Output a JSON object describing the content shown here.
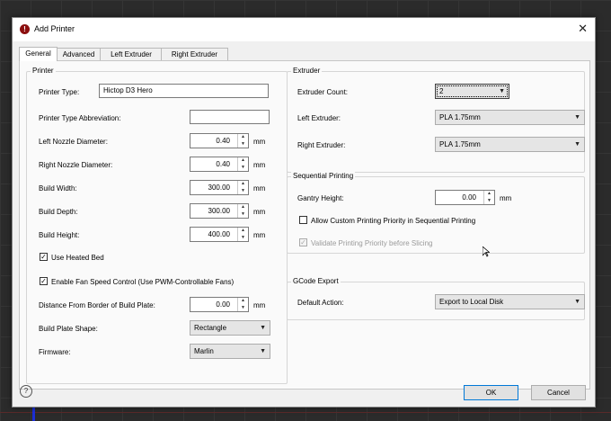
{
  "window": {
    "title": "Add Printer",
    "close_glyph": "✕",
    "app_icon_glyph": "!"
  },
  "tabs": [
    {
      "label": "General",
      "active": true
    },
    {
      "label": "Advanced",
      "active": false
    },
    {
      "label": "Left Extruder",
      "active": false
    },
    {
      "label": "Right Extruder",
      "active": false
    }
  ],
  "printer_group": {
    "title": "Printer",
    "printer_type": {
      "label": "Printer Type:",
      "value": "Hictop D3 Hero"
    },
    "abbreviation": {
      "label": "Printer Type Abbreviation:",
      "value": ""
    },
    "left_nozzle": {
      "label": "Left Nozzle Diameter:",
      "value": "0.40",
      "unit": "mm"
    },
    "right_nozzle": {
      "label": "Right Nozzle Diameter:",
      "value": "0.40",
      "unit": "mm"
    },
    "build_width": {
      "label": "Build Width:",
      "value": "300.00",
      "unit": "mm"
    },
    "build_depth": {
      "label": "Build Depth:",
      "value": "300.00",
      "unit": "mm"
    },
    "build_height": {
      "label": "Build Height:",
      "value": "400.00",
      "unit": "mm"
    },
    "heated_bed": {
      "label": "Use Heated Bed",
      "checked": true
    },
    "fan_speed": {
      "label": "Enable Fan Speed Control (Use PWM-Controllable Fans)",
      "checked": true
    },
    "border_distance": {
      "label": "Distance From Border of Build Plate:",
      "value": "0.00",
      "unit": "mm"
    },
    "plate_shape": {
      "label": "Build Plate Shape:",
      "value": "Rectangle"
    },
    "firmware": {
      "label": "Firmware:",
      "value": "Marlin"
    }
  },
  "extruder_group": {
    "title": "Extruder",
    "count": {
      "label": "Extruder Count:",
      "value": "2"
    },
    "left": {
      "label": "Left Extruder:",
      "value": "PLA 1.75mm"
    },
    "right": {
      "label": "Right Extruder:",
      "value": "PLA 1.75mm"
    }
  },
  "sequential_group": {
    "title": "Sequential Printing",
    "gantry_height": {
      "label": "Gantry Height:",
      "value": "0.00",
      "unit": "mm"
    },
    "custom_priority": {
      "label": "Allow Custom Printing Priority in Sequential Printing",
      "checked": false
    },
    "validate_priority": {
      "label": "Validate Printing Priority before Slicing",
      "checked": true,
      "disabled": true
    }
  },
  "gcode_group": {
    "title": "GCode Export",
    "default_action": {
      "label": "Default Action:",
      "value": "Export to Local Disk"
    }
  },
  "footer": {
    "help_glyph": "?",
    "ok_label": "OK",
    "cancel_label": "Cancel"
  },
  "glyphs": {
    "check": "✓",
    "caret": "▼",
    "up": "▲",
    "down": "▼"
  }
}
